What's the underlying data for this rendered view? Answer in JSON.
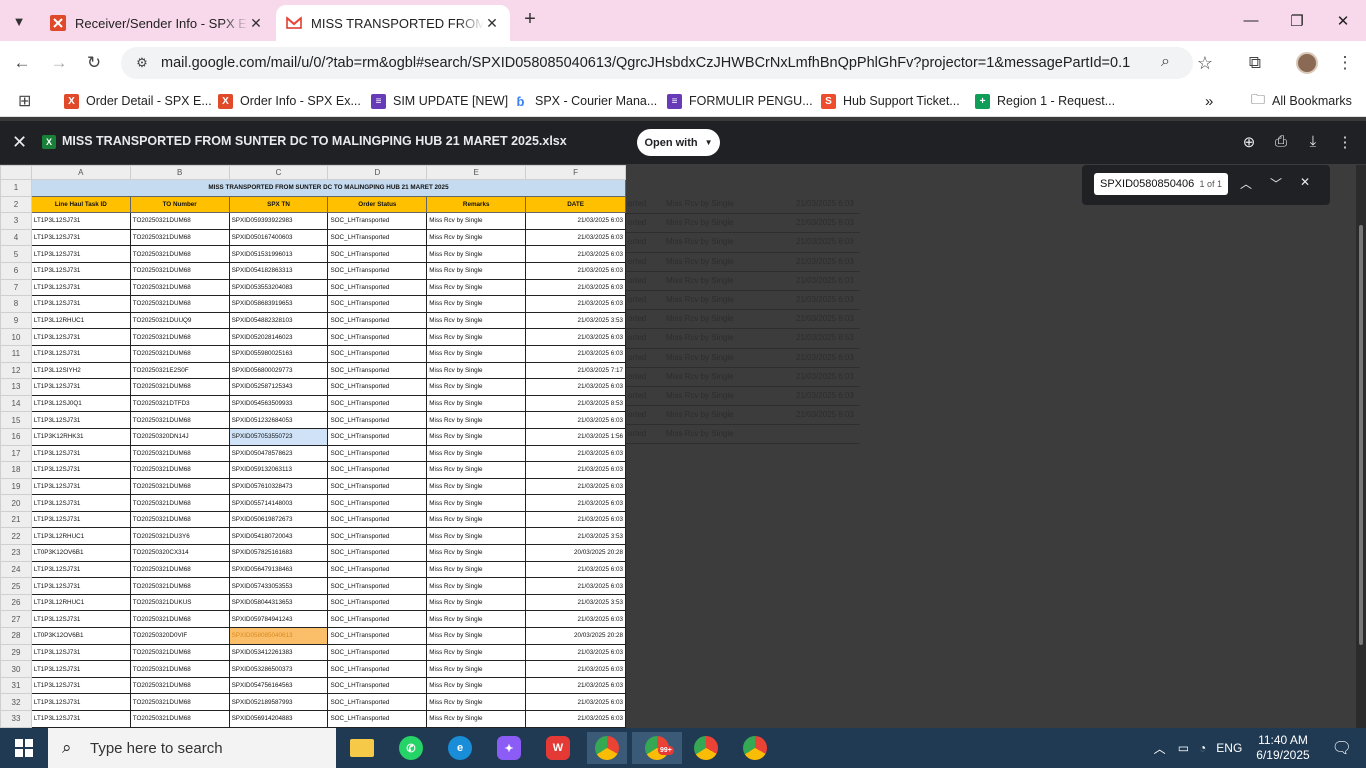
{
  "browser": {
    "tabs": [
      {
        "title": "Receiver/Sender Info - SPX Expr",
        "active": false
      },
      {
        "title": "MISS TRANSPORTED FROM SUNTER",
        "active": true
      }
    ],
    "url": "mail.google.com/mail/u/0/?tab=rm&ogbl#search/SPXID058085040613/QgrcJHsbdxCzJHWBCrNxLmfhBnQpPhlGhFv?projector=1&messagePartId=0.1",
    "bookmarks": [
      {
        "label": "Order Detail - SPX E...",
        "icon": "spx-x-icon"
      },
      {
        "label": "Order Info - SPX Ex...",
        "icon": "spx-x-icon"
      },
      {
        "label": "SIM UPDATE [NEW]",
        "icon": "forms-icon"
      },
      {
        "label": "SPX - Courier Mana...",
        "icon": "courier-icon"
      },
      {
        "label": "FORMULIR PENGU...",
        "icon": "forms-icon"
      },
      {
        "label": "Hub Support Ticket...",
        "icon": "bag-icon"
      },
      {
        "label": "Region 1 - Request...",
        "icon": "plus-sheet-icon"
      }
    ],
    "more_bookmarks": "»",
    "all_bookmarks": "All Bookmarks"
  },
  "viewer": {
    "filename": "MISS TRANSPORTED FROM SUNTER DC TO MALINGPING HUB 21 MARET 2025.xlsx",
    "open_with": "Open with",
    "find": {
      "query": "SPXID0580850406",
      "count": "1 of 1"
    }
  },
  "sheet": {
    "columns": [
      "A",
      "B",
      "C",
      "D",
      "E",
      "F"
    ],
    "title": "MISS TRANSPORTED FROM SUNTER DC TO MALINGPING HUB 21 MARET 2025",
    "headers": [
      "Line Haul Task ID",
      "TO Number",
      "SPX TN",
      "Order Status",
      "Remarks",
      "DATE"
    ],
    "rows": [
      [
        "LT1P3L12SJ731",
        "TO20250321DUM68",
        "SPXID059393922983",
        "SOC_LHTransported",
        "Miss Rcv by Single",
        "21/03/2025 6:03"
      ],
      [
        "LT1P3L12SJ731",
        "TO20250321DUM68",
        "SPXID050167400603",
        "SOC_LHTransported",
        "Miss Rcv by Single",
        "21/03/2025 6:03"
      ],
      [
        "LT1P3L12SJ731",
        "TO20250321DUM68",
        "SPXID051531996013",
        "SOC_LHTransported",
        "Miss Rcv by Single",
        "21/03/2025 6:03"
      ],
      [
        "LT1P3L12SJ731",
        "TO20250321DUM68",
        "SPXID054182863313",
        "SOC_LHTransported",
        "Miss Rcv by Single",
        "21/03/2025 6:03"
      ],
      [
        "LT1P3L12SJ731",
        "TO20250321DUM68",
        "SPXID053553204083",
        "SOC_LHTransported",
        "Miss Rcv by Single",
        "21/03/2025 6:03"
      ],
      [
        "LT1P3L12SJ731",
        "TO20250321DUM68",
        "SPXID058683919653",
        "SOC_LHTransported",
        "Miss Rcv by Single",
        "21/03/2025 6:03"
      ],
      [
        "LT1P3L12RHUC1",
        "TO20250321DUUQ9",
        "SPXID054882328103",
        "SOC_LHTransported",
        "Miss Rcv by Single",
        "21/03/2025 3:53"
      ],
      [
        "LT1P3L12SJ731",
        "TO20250321DUM68",
        "SPXID052028146023",
        "SOC_LHTransported",
        "Miss Rcv by Single",
        "21/03/2025 6:03"
      ],
      [
        "LT1P3L12SJ731",
        "TO20250321DUM68",
        "SPXID055980025163",
        "SOC_LHTransported",
        "Miss Rcv by Single",
        "21/03/2025 6:03"
      ],
      [
        "LT1P3L12SIYH2",
        "TO20250321E2S0F",
        "SPXID056800029773",
        "SOC_LHTransported",
        "Miss Rcv by Single",
        "21/03/2025 7:17"
      ],
      [
        "LT1P3L12SJ731",
        "TO20250321DUM68",
        "SPXID052587125343",
        "SOC_LHTransported",
        "Miss Rcv by Single",
        "21/03/2025 6:03"
      ],
      [
        "LT1P3L12SJ0Q1",
        "TO20250321DTFD3",
        "SPXID054563509933",
        "SOC_LHTransported",
        "Miss Rcv by Single",
        "21/03/2025 8:53"
      ],
      [
        "LT1P3L12SJ731",
        "TO20250321DUM68",
        "SPXID051232684053",
        "SOC_LHTransported",
        "Miss Rcv by Single",
        "21/03/2025 6:03"
      ],
      [
        "LT1P3K12RHK31",
        "TO20250320DN14J",
        "SPXID057053550723",
        "SOC_LHTransported",
        "Miss Rcv by Single",
        "21/03/2025 1:56"
      ],
      [
        "LT1P3L12SJ731",
        "TO20250321DUM68",
        "SPXID050478578623",
        "SOC_LHTransported",
        "Miss Rcv by Single",
        "21/03/2025 6:03"
      ],
      [
        "LT1P3L12SJ731",
        "TO20250321DUM68",
        "SPXID059132063113",
        "SOC_LHTransported",
        "Miss Rcv by Single",
        "21/03/2025 6:03"
      ],
      [
        "LT1P3L12SJ731",
        "TO20250321DUM68",
        "SPXID057610328473",
        "SOC_LHTransported",
        "Miss Rcv by Single",
        "21/03/2025 6:03"
      ],
      [
        "LT1P3L12SJ731",
        "TO20250321DUM68",
        "SPXID055714148003",
        "SOC_LHTransported",
        "Miss Rcv by Single",
        "21/03/2025 6:03"
      ],
      [
        "LT1P3L12SJ731",
        "TO20250321DUM68",
        "SPXID050619872673",
        "SOC_LHTransported",
        "Miss Rcv by Single",
        "21/03/2025 6:03"
      ],
      [
        "LT1P3L12RHUC1",
        "TO20250321DU3Y6",
        "SPXID054180720043",
        "SOC_LHTransported",
        "Miss Rcv by Single",
        "21/03/2025 3:53"
      ],
      [
        "LT0P3K12OV6B1",
        "TO20250320CX314",
        "SPXID057825161683",
        "SOC_LHTransported",
        "Miss Rcv by Single",
        "20/03/2025 20:28"
      ],
      [
        "LT1P3L12SJ731",
        "TO20250321DUM68",
        "SPXID056479138463",
        "SOC_LHTransported",
        "Miss Rcv by Single",
        "21/03/2025 6:03"
      ],
      [
        "LT1P3L12SJ731",
        "TO20250321DUM68",
        "SPXID057433053553",
        "SOC_LHTransported",
        "Miss Rcv by Single",
        "21/03/2025 6:03"
      ],
      [
        "LT1P3L12RHUC1",
        "TO20250321DUKUS",
        "SPXID058044313653",
        "SOC_LHTransported",
        "Miss Rcv by Single",
        "21/03/2025 3:53"
      ],
      [
        "LT1P3L12SJ731",
        "TO20250321DUM68",
        "SPXID059784941243",
        "SOC_LHTransported",
        "Miss Rcv by Single",
        "21/03/2025 6:03"
      ],
      [
        "LT0P3K12OV6B1",
        "TO20250320D0VIF",
        "SPXID058085040613",
        "SOC_LHTransported",
        "Miss Rcv by Single",
        "20/03/2025 20:28"
      ],
      [
        "LT1P3L12SJ731",
        "TO20250321DUM68",
        "SPXID053412261383",
        "SOC_LHTransported",
        "Miss Rcv by Single",
        "21/03/2025 6:03"
      ],
      [
        "LT1P3L12SJ731",
        "TO20250321DUM68",
        "SPXID053286500373",
        "SOC_LHTransported",
        "Miss Rcv by Single",
        "21/03/2025 6:03"
      ],
      [
        "LT1P3L12SJ731",
        "TO20250321DUM68",
        "SPXID054756164563",
        "SOC_LHTransported",
        "Miss Rcv by Single",
        "21/03/2025 6:03"
      ],
      [
        "LT1P3L12SJ731",
        "TO20250321DUM68",
        "SPXID052189587993",
        "SOC_LHTransported",
        "Miss Rcv by Single",
        "21/03/2025 6:03"
      ],
      [
        "LT1P3L12SJ731",
        "TO20250321DUM68",
        "SPXID056914204883",
        "SOC_LHTransported",
        "Miss Rcv by Single",
        "21/03/2025 6:03"
      ]
    ],
    "selected_row": 13,
    "found_row": 25
  },
  "ghost_rows": [
    [
      "orted",
      "Miss Rcv by Single",
      "21/03/2025 6:03"
    ],
    [
      "orted",
      "Miss Rcv by Single",
      "21/03/2025 6:03"
    ],
    [
      "orted",
      "Miss Rcv by Single",
      "21/03/2025 6:03"
    ],
    [
      "orted",
      "Miss Rcv by Single",
      "21/03/2025 6:03"
    ],
    [
      "orted",
      "Miss Rcv by Single",
      "21/03/2025 6:03"
    ],
    [
      "orted",
      "Miss Rcv by Single",
      "21/03/2025 6:03"
    ],
    [
      "orted",
      "Miss Rcv by Single",
      "21/03/2025 6:03"
    ],
    [
      "orted",
      "Miss Rcv by Single",
      "21/03/2025 8:53"
    ],
    [
      "orted",
      "Miss Rcv by Single",
      "21/03/2025 6:03"
    ],
    [
      "orted",
      "Miss Rcv by Single",
      "21/03/2025 6:03"
    ],
    [
      "orted",
      "Miss Rcv by Single",
      "21/03/2025 6:03"
    ],
    [
      "orted",
      "Miss Rcv by Single",
      "21/03/2025 6:03"
    ],
    [
      "orted",
      "Miss Rcv by Single",
      ""
    ]
  ],
  "taskbar": {
    "search_placeholder": "Type here to search",
    "notif_badge": "99+",
    "lang": "ENG",
    "time": "11:40 AM",
    "date": "6/19/2025"
  },
  "colors": {
    "tab_strip": "#f8d9ec",
    "header_fill": "#ffc000",
    "title_fill": "#c5dcf0",
    "found": "#fbbf6a",
    "taskbar": "#1f3a52"
  }
}
